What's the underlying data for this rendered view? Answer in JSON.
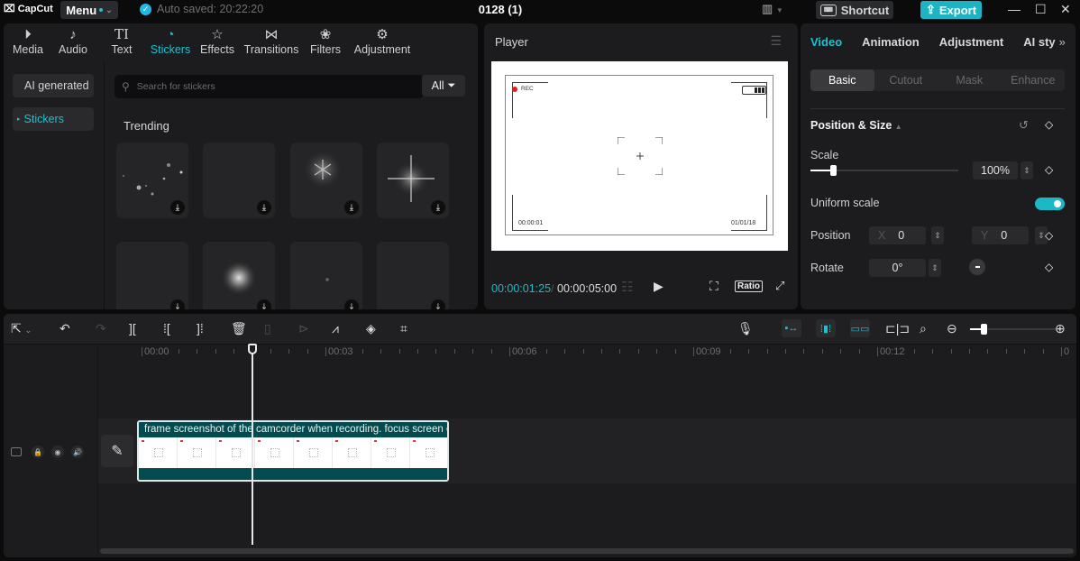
{
  "titlebar": {
    "app_name": "CapCut",
    "menu_label": "Menu",
    "autosave_text": "Auto saved: 20:22:20",
    "project_title": "0128 (1)",
    "shortcut_label": "Shortcut",
    "export_label": "Export"
  },
  "media_panel": {
    "tabs": [
      {
        "label": "Media",
        "icon": "media-icon"
      },
      {
        "label": "Audio",
        "icon": "audio-icon"
      },
      {
        "label": "Text",
        "icon": "text-icon"
      },
      {
        "label": "Stickers",
        "icon": "stickers-icon",
        "active": true
      },
      {
        "label": "Effects",
        "icon": "effects-icon"
      },
      {
        "label": "Transitions",
        "icon": "transitions-icon"
      },
      {
        "label": "Filters",
        "icon": "filters-icon"
      },
      {
        "label": "Adjustment",
        "icon": "adjustment-icon"
      }
    ],
    "sidebar": [
      {
        "label": "AI generated"
      },
      {
        "label": "Stickers",
        "active": true
      }
    ],
    "search_placeholder": "Search for stickers",
    "filter_label": "All",
    "section_title": "Trending",
    "stickers": [
      {
        "name": "scattered-dots"
      },
      {
        "name": "blank"
      },
      {
        "name": "snowflake-glow"
      },
      {
        "name": "four-point-sparkle"
      },
      {
        "name": "blank"
      },
      {
        "name": "burst-sparkle"
      },
      {
        "name": "tiny-dot"
      },
      {
        "name": "blank"
      }
    ]
  },
  "player": {
    "title": "Player",
    "viewfinder": {
      "rec_label": "REC",
      "timecode": "00:00:01",
      "date": "01/01/18"
    },
    "current_time": "00:00:01:25",
    "total_time": "00:00:05:00",
    "ratio_label": "Ratio"
  },
  "details": {
    "tabs": [
      {
        "label": "Video",
        "active": true
      },
      {
        "label": "Animation"
      },
      {
        "label": "Adjustment"
      },
      {
        "label": "AI sty"
      }
    ],
    "subtabs": [
      {
        "label": "Basic",
        "active": true
      },
      {
        "label": "Cutout"
      },
      {
        "label": "Mask"
      },
      {
        "label": "Enhance"
      }
    ],
    "section_title": "Position & Size",
    "scale_label": "Scale",
    "scale_value": "100%",
    "scale_fraction": 0.15,
    "uniform_scale_label": "Uniform scale",
    "uniform_scale_on": true,
    "position_label": "Position",
    "pos_x_label": "X",
    "pos_x": "0",
    "pos_y_label": "Y",
    "pos_y": "0",
    "rotate_label": "Rotate",
    "rotate_value": "0°"
  },
  "timeline": {
    "ruler_labels": [
      "00:00",
      "00:03",
      "00:06",
      "00:09",
      "00:12",
      "0"
    ],
    "clip_title": "frame screenshot of the camcorder when recording. focus screen or"
  }
}
